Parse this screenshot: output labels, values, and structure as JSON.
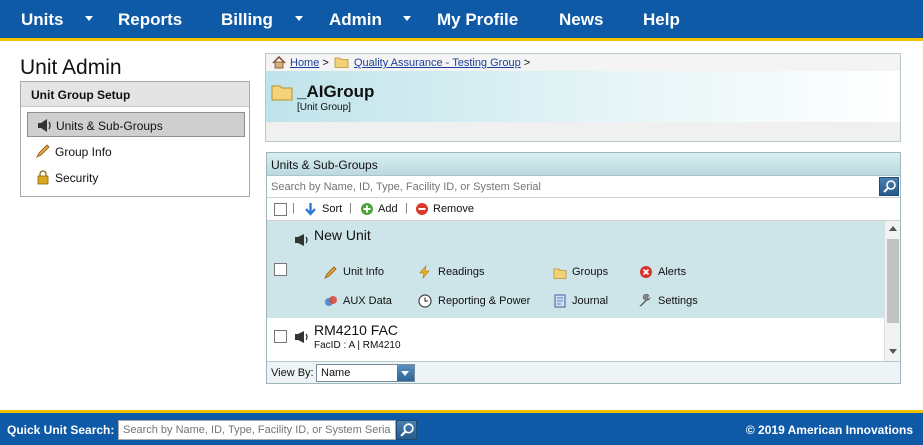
{
  "nav": {
    "items": [
      "Units",
      "Reports",
      "Billing",
      "Admin",
      "My Profile",
      "News",
      "Help"
    ]
  },
  "page": {
    "title": "Unit Admin"
  },
  "sidebar": {
    "heading": "Unit Group Setup",
    "items": [
      {
        "label": "Units & Sub-Groups",
        "icon": "megaphone-icon",
        "active": true
      },
      {
        "label": "Group Info",
        "icon": "pencil-icon"
      },
      {
        "label": "Security",
        "icon": "lock-icon"
      }
    ]
  },
  "breadcrumb": {
    "home": "Home",
    "sep": ">",
    "group_link": "Quality Assurance - Testing Group"
  },
  "group": {
    "name": "_AIGroup",
    "type": "[Unit Group]"
  },
  "units_panel": {
    "title": "Units & Sub-Groups",
    "search_placeholder": "Search by Name, ID, Type, Facility ID, or System Serial",
    "toolbar": {
      "sort": "Sort",
      "add": "Add",
      "remove": "Remove"
    },
    "units": [
      {
        "name": "New Unit",
        "actions": [
          "Unit Info",
          "Readings",
          "Groups",
          "Alerts",
          "AUX Data",
          "Reporting & Power",
          "Journal",
          "Settings"
        ]
      },
      {
        "name": "RM4210 FAC",
        "detail": "FacID : A | RM4210"
      }
    ],
    "view_by_label": "View By:",
    "view_by_value": "Name"
  },
  "footer": {
    "quick_search_label": "Quick Unit Search:",
    "quick_search_placeholder": "Search by Name, ID, Type, Facility ID, or System Serial",
    "copyright": "© 2019 American Innovations"
  },
  "colors": {
    "nav_blue": "#0f5aa7",
    "accent_yellow": "#f2c200",
    "selected_row": "#cde4e8"
  }
}
